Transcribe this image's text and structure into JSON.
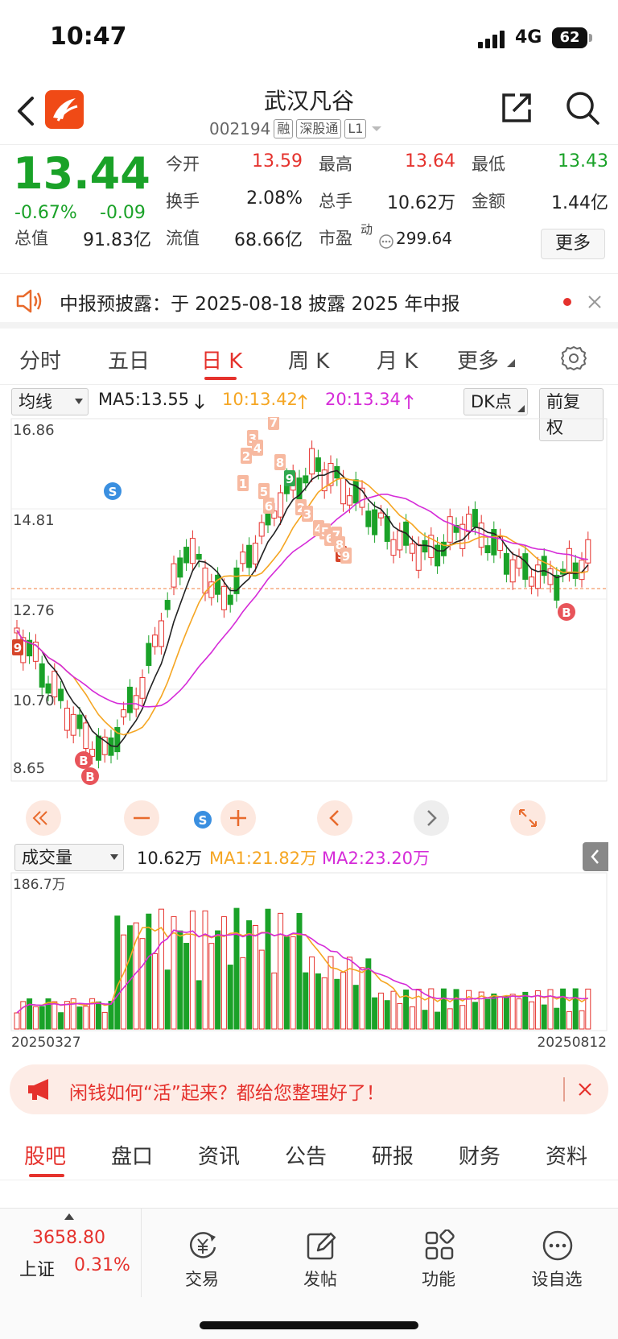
{
  "status": {
    "time": "10:47",
    "network": "4G",
    "battery": "62"
  },
  "header": {
    "stock_name": "武汉凡谷",
    "code": "002194",
    "tags": [
      "融",
      "深股通",
      "L1"
    ]
  },
  "quote": {
    "price": "13.44",
    "change_pct": "-0.67%",
    "change": "-0.09",
    "fields": {
      "open_label": "今开",
      "open": "13.59",
      "high_label": "最高",
      "high": "13.64",
      "low_label": "最低",
      "low": "13.43",
      "turnover_label": "换手",
      "turnover": "2.08%",
      "volume_label": "总手",
      "volume": "10.62万",
      "amount_label": "金额",
      "amount": "1.44亿",
      "mcap_label": "总值",
      "mcap": "91.83亿",
      "float_label": "流值",
      "float": "68.66亿",
      "pe_label": "市盈",
      "pe_sup": "动",
      "pe": "299.64"
    },
    "more_label": "更多"
  },
  "notice": {
    "text": "中报预披露：于 2025-08-18 披露 2025 年中报"
  },
  "tabs": [
    "分时",
    "五日",
    "日 K",
    "周 K",
    "月 K",
    "更多"
  ],
  "active_tab": 2,
  "ma_row": {
    "selector": "均线",
    "ma5": "MA5:13.55",
    "ma10": "10:13.42",
    "ma20": "20:13.34",
    "dk": "DK点",
    "adjust": "前复权"
  },
  "kline_axis": [
    "16.86",
    "14.81",
    "12.76",
    "10.70",
    "8.65"
  ],
  "kline_badges": [
    "S",
    "B",
    "B",
    "S",
    "B",
    "9",
    "9",
    "9",
    "1",
    "2",
    "3",
    "4",
    "5",
    "6",
    "7",
    "8",
    "2",
    "3",
    "4",
    "5",
    "6",
    "7",
    "8",
    "9"
  ],
  "vol_row": {
    "selector": "成交量",
    "value": "10.62万",
    "ma1": "MA1:21.82万",
    "ma2": "MA2:23.20万"
  },
  "vol_axis": {
    "top": "186.7万"
  },
  "date_range": {
    "start": "20250327",
    "end": "20250812"
  },
  "promo": {
    "text": "闲钱如何“活”起来？都给您整理好了！"
  },
  "bottom_tabs": [
    "股吧",
    "盘口",
    "资讯",
    "公告",
    "研报",
    "财务",
    "资料"
  ],
  "bottom_nav": {
    "index_value": "3658.80",
    "index_name": "上证",
    "index_pct": "0.31%",
    "buttons": [
      "交易",
      "发帖",
      "功能",
      "设自选"
    ]
  },
  "colors": {
    "up": "#e5322d",
    "down": "#1aa228",
    "ma5": "#222222",
    "ma10": "#f5a623",
    "ma20": "#d52bd8"
  }
}
